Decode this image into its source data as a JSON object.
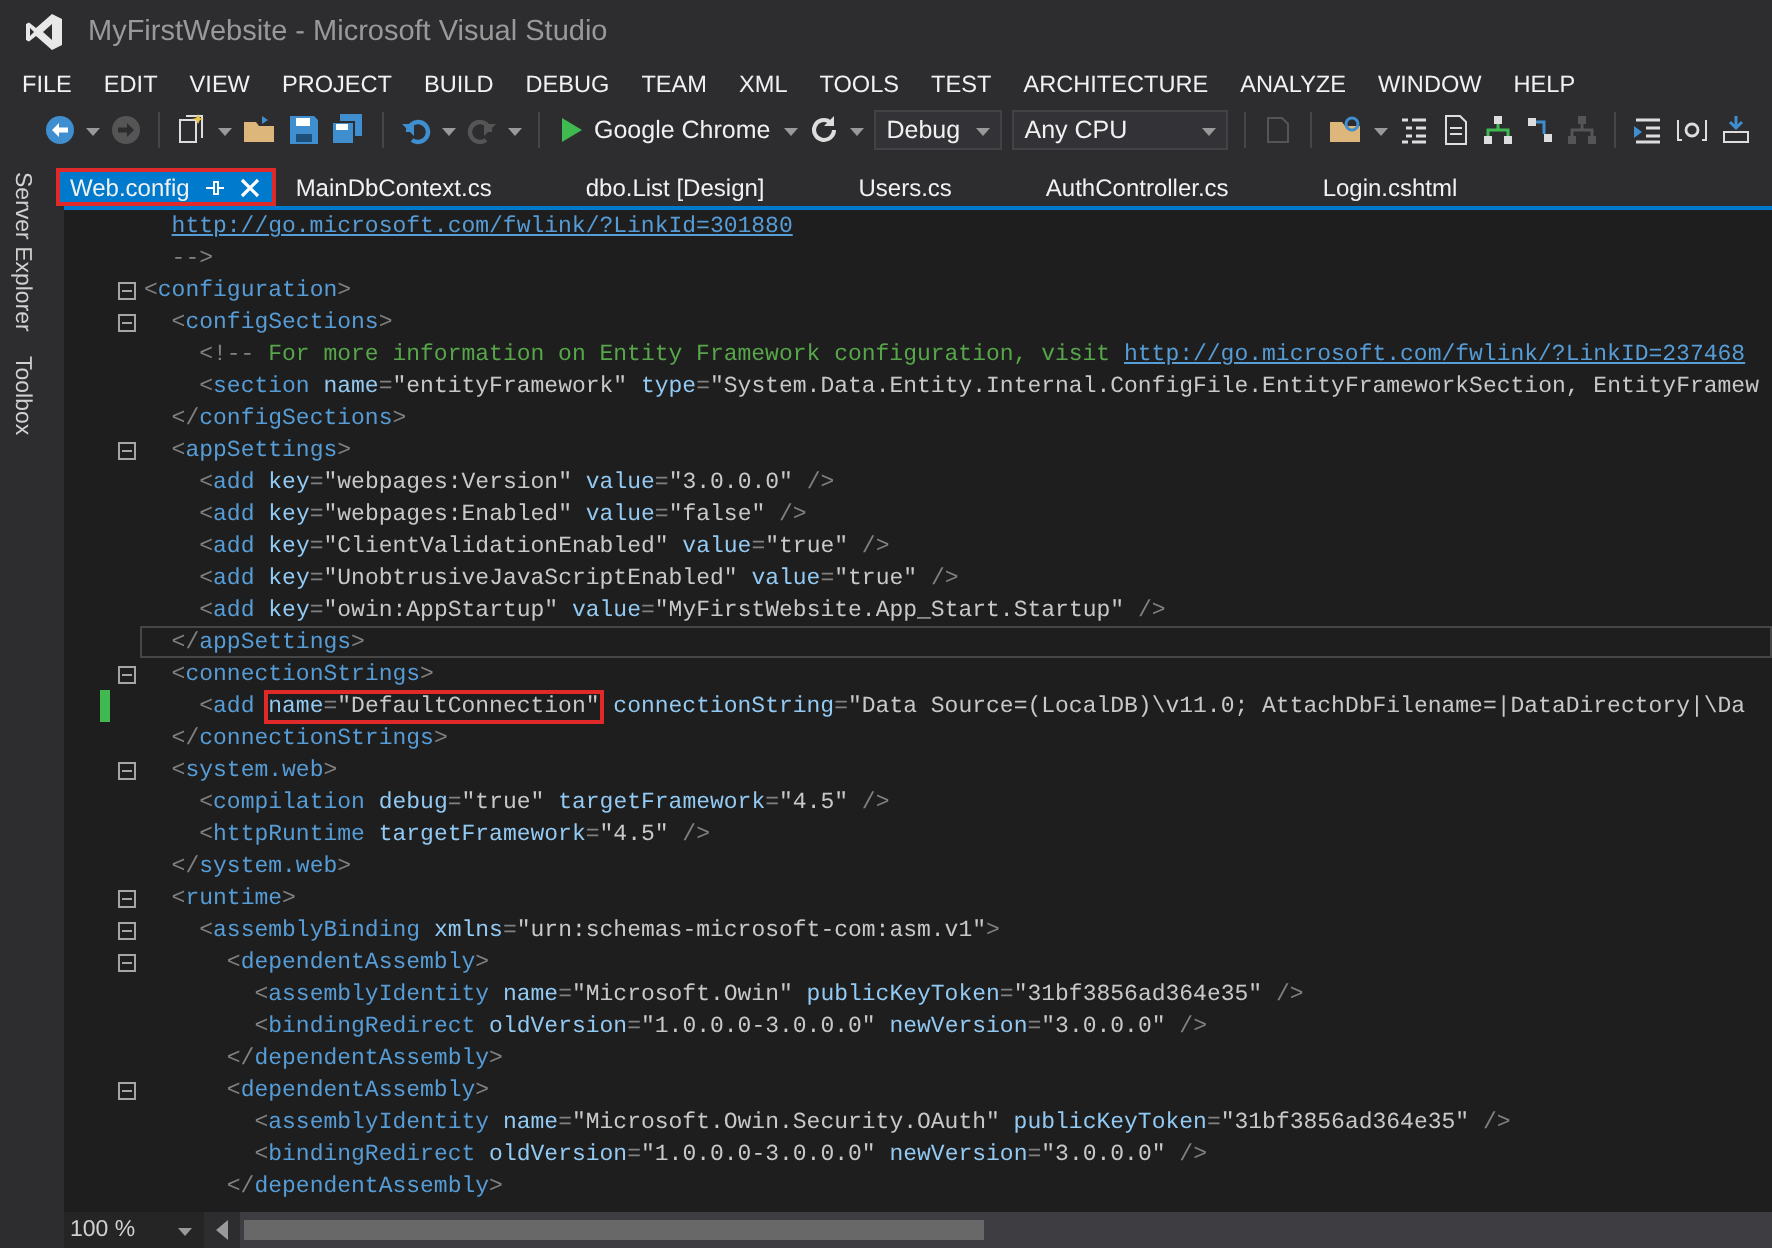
{
  "window": {
    "title": "MyFirstWebsite - Microsoft Visual Studio"
  },
  "menu": [
    "FILE",
    "EDIT",
    "VIEW",
    "PROJECT",
    "BUILD",
    "DEBUG",
    "TEAM",
    "XML",
    "TOOLS",
    "TEST",
    "ARCHITECTURE",
    "ANALYZE",
    "WINDOW",
    "HELP"
  ],
  "toolbar": {
    "run_target": "Google Chrome",
    "configuration": "Debug",
    "platform": "Any CPU"
  },
  "side_tabs": [
    "Server Explorer",
    "Toolbox"
  ],
  "tabs": [
    {
      "label": "Web.config",
      "selected": true,
      "highlighted": true
    },
    {
      "label": "MainDbContext.cs",
      "selected": false,
      "highlighted": false
    },
    {
      "label": "dbo.List [Design]",
      "selected": false,
      "highlighted": false
    },
    {
      "label": "Users.cs",
      "selected": false,
      "highlighted": false
    },
    {
      "label": "AuthController.cs",
      "selected": false,
      "highlighted": false
    },
    {
      "label": "Login.cshtml",
      "selected": false,
      "highlighted": false
    }
  ],
  "editor": {
    "lines": [
      {
        "kind": "continuation",
        "fold": false,
        "changed": false,
        "current": false,
        "tokens": [
          {
            "kind": "link",
            "text": "http://go.microsoft.com/fwlink/?LinkId=301880"
          }
        ]
      },
      {
        "kind": "markup",
        "fold": false,
        "changed": false,
        "current": false,
        "tokens": [
          {
            "kind": "punct",
            "text": "  -->"
          }
        ]
      },
      {
        "kind": "markup",
        "fold": true,
        "changed": false,
        "current": false,
        "tokens": [
          {
            "kind": "punct",
            "text": "<"
          },
          {
            "kind": "tag",
            "text": "configuration"
          },
          {
            "kind": "punct",
            "text": ">"
          }
        ]
      },
      {
        "kind": "markup",
        "fold": true,
        "changed": false,
        "current": false,
        "tokens": [
          {
            "kind": "punct",
            "text": "  <"
          },
          {
            "kind": "tag",
            "text": "configSections"
          },
          {
            "kind": "punct",
            "text": ">"
          }
        ]
      },
      {
        "kind": "markup",
        "fold": false,
        "changed": false,
        "current": false,
        "tokens": [
          {
            "kind": "punct",
            "text": "    <!--"
          },
          {
            "kind": "comment",
            "text": " For more information on Entity Framework configuration, visit "
          },
          {
            "kind": "link",
            "text": "http://go.microsoft.com/fwlink/?LinkID=237468"
          }
        ]
      },
      {
        "kind": "markup",
        "fold": false,
        "changed": false,
        "current": false,
        "tokens": [
          {
            "kind": "punct",
            "text": "    <"
          },
          {
            "kind": "tag",
            "text": "section"
          },
          {
            "kind": "attr",
            "text": " name"
          },
          {
            "kind": "punct",
            "text": "="
          },
          {
            "kind": "value",
            "text": "\"entityFramework\""
          },
          {
            "kind": "attr",
            "text": " type"
          },
          {
            "kind": "punct",
            "text": "="
          },
          {
            "kind": "value",
            "text": "\"System.Data.Entity.Internal.ConfigFile.EntityFrameworkSection, EntityFramew"
          }
        ]
      },
      {
        "kind": "markup",
        "fold": false,
        "changed": false,
        "current": false,
        "tokens": [
          {
            "kind": "punct",
            "text": "  </"
          },
          {
            "kind": "tag",
            "text": "configSections"
          },
          {
            "kind": "punct",
            "text": ">"
          }
        ]
      },
      {
        "kind": "markup",
        "fold": true,
        "changed": false,
        "current": false,
        "tokens": [
          {
            "kind": "punct",
            "text": "  <"
          },
          {
            "kind": "tag",
            "text": "appSettings"
          },
          {
            "kind": "punct",
            "text": ">"
          }
        ]
      },
      {
        "kind": "markup",
        "fold": false,
        "changed": false,
        "current": false,
        "tokens": [
          {
            "kind": "punct",
            "text": "    <"
          },
          {
            "kind": "tag",
            "text": "add"
          },
          {
            "kind": "attr",
            "text": " key"
          },
          {
            "kind": "punct",
            "text": "="
          },
          {
            "kind": "value",
            "text": "\"webpages:Version\""
          },
          {
            "kind": "attr",
            "text": " value"
          },
          {
            "kind": "punct",
            "text": "="
          },
          {
            "kind": "value",
            "text": "\"3.0.0.0\""
          },
          {
            "kind": "punct",
            "text": " />"
          }
        ]
      },
      {
        "kind": "markup",
        "fold": false,
        "changed": false,
        "current": false,
        "tokens": [
          {
            "kind": "punct",
            "text": "    <"
          },
          {
            "kind": "tag",
            "text": "add"
          },
          {
            "kind": "attr",
            "text": " key"
          },
          {
            "kind": "punct",
            "text": "="
          },
          {
            "kind": "value",
            "text": "\"webpages:Enabled\""
          },
          {
            "kind": "attr",
            "text": " value"
          },
          {
            "kind": "punct",
            "text": "="
          },
          {
            "kind": "value",
            "text": "\"false\""
          },
          {
            "kind": "punct",
            "text": " />"
          }
        ]
      },
      {
        "kind": "markup",
        "fold": false,
        "changed": false,
        "current": false,
        "tokens": [
          {
            "kind": "punct",
            "text": "    <"
          },
          {
            "kind": "tag",
            "text": "add"
          },
          {
            "kind": "attr",
            "text": " key"
          },
          {
            "kind": "punct",
            "text": "="
          },
          {
            "kind": "value",
            "text": "\"ClientValidationEnabled\""
          },
          {
            "kind": "attr",
            "text": " value"
          },
          {
            "kind": "punct",
            "text": "="
          },
          {
            "kind": "value",
            "text": "\"true\""
          },
          {
            "kind": "punct",
            "text": " />"
          }
        ]
      },
      {
        "kind": "markup",
        "fold": false,
        "changed": false,
        "current": false,
        "tokens": [
          {
            "kind": "punct",
            "text": "    <"
          },
          {
            "kind": "tag",
            "text": "add"
          },
          {
            "kind": "attr",
            "text": " key"
          },
          {
            "kind": "punct",
            "text": "="
          },
          {
            "kind": "value",
            "text": "\"UnobtrusiveJavaScriptEnabled\""
          },
          {
            "kind": "attr",
            "text": " value"
          },
          {
            "kind": "punct",
            "text": "="
          },
          {
            "kind": "value",
            "text": "\"true\""
          },
          {
            "kind": "punct",
            "text": " />"
          }
        ]
      },
      {
        "kind": "markup",
        "fold": false,
        "changed": false,
        "current": false,
        "tokens": [
          {
            "kind": "punct",
            "text": "    <"
          },
          {
            "kind": "tag",
            "text": "add"
          },
          {
            "kind": "attr",
            "text": " key"
          },
          {
            "kind": "punct",
            "text": "="
          },
          {
            "kind": "value",
            "text": "\"owin:AppStartup\""
          },
          {
            "kind": "attr",
            "text": " value"
          },
          {
            "kind": "punct",
            "text": "="
          },
          {
            "kind": "value",
            "text": "\"MyFirstWebsite.App_Start.Startup\""
          },
          {
            "kind": "punct",
            "text": " />"
          }
        ]
      },
      {
        "kind": "markup",
        "fold": false,
        "changed": false,
        "current": true,
        "tokens": [
          {
            "kind": "punct",
            "text": "  </"
          },
          {
            "kind": "tag",
            "text": "appSettings"
          },
          {
            "kind": "punct",
            "text": ">"
          }
        ]
      },
      {
        "kind": "markup",
        "fold": true,
        "changed": false,
        "current": false,
        "tokens": [
          {
            "kind": "punct",
            "text": "  <"
          },
          {
            "kind": "tag",
            "text": "connectionStrings"
          },
          {
            "kind": "punct",
            "text": ">"
          }
        ]
      },
      {
        "kind": "markup",
        "fold": false,
        "changed": true,
        "current": false,
        "tokens": [
          {
            "kind": "punct",
            "text": "    <"
          },
          {
            "kind": "tag",
            "text": "add "
          },
          {
            "kind": "marked",
            "tokens": [
              {
                "kind": "attr",
                "text": "name"
              },
              {
                "kind": "punct",
                "text": "="
              },
              {
                "kind": "value",
                "text": "\"DefaultConnection\""
              }
            ]
          },
          {
            "kind": "attr",
            "text": " connectionString"
          },
          {
            "kind": "punct",
            "text": "="
          },
          {
            "kind": "value",
            "text": "\"Data Source=(LocalDB)\\v11.0; AttachDbFilename=|DataDirectory|\\Da"
          }
        ]
      },
      {
        "kind": "markup",
        "fold": false,
        "changed": false,
        "current": false,
        "tokens": [
          {
            "kind": "punct",
            "text": "  </"
          },
          {
            "kind": "tag",
            "text": "connectionStrings"
          },
          {
            "kind": "punct",
            "text": ">"
          }
        ]
      },
      {
        "kind": "markup",
        "fold": true,
        "changed": false,
        "current": false,
        "tokens": [
          {
            "kind": "punct",
            "text": "  <"
          },
          {
            "kind": "tag",
            "text": "system.web"
          },
          {
            "kind": "punct",
            "text": ">"
          }
        ]
      },
      {
        "kind": "markup",
        "fold": false,
        "changed": false,
        "current": false,
        "tokens": [
          {
            "kind": "punct",
            "text": "    <"
          },
          {
            "kind": "tag",
            "text": "compilation"
          },
          {
            "kind": "attr",
            "text": " debug"
          },
          {
            "kind": "punct",
            "text": "="
          },
          {
            "kind": "value",
            "text": "\"true\""
          },
          {
            "kind": "attr",
            "text": " targetFramework"
          },
          {
            "kind": "punct",
            "text": "="
          },
          {
            "kind": "value",
            "text": "\"4.5\""
          },
          {
            "kind": "punct",
            "text": " />"
          }
        ]
      },
      {
        "kind": "markup",
        "fold": false,
        "changed": false,
        "current": false,
        "tokens": [
          {
            "kind": "punct",
            "text": "    <"
          },
          {
            "kind": "tag",
            "text": "httpRuntime"
          },
          {
            "kind": "attr",
            "text": " targetFramework"
          },
          {
            "kind": "punct",
            "text": "="
          },
          {
            "kind": "value",
            "text": "\"4.5\""
          },
          {
            "kind": "punct",
            "text": " />"
          }
        ]
      },
      {
        "kind": "markup",
        "fold": false,
        "changed": false,
        "current": false,
        "tokens": [
          {
            "kind": "punct",
            "text": "  </"
          },
          {
            "kind": "tag",
            "text": "system.web"
          },
          {
            "kind": "punct",
            "text": ">"
          }
        ]
      },
      {
        "kind": "markup",
        "fold": true,
        "changed": false,
        "current": false,
        "tokens": [
          {
            "kind": "punct",
            "text": "  <"
          },
          {
            "kind": "tag",
            "text": "runtime"
          },
          {
            "kind": "punct",
            "text": ">"
          }
        ]
      },
      {
        "kind": "markup",
        "fold": true,
        "changed": false,
        "current": false,
        "tokens": [
          {
            "kind": "punct",
            "text": "    <"
          },
          {
            "kind": "tag",
            "text": "assemblyBinding"
          },
          {
            "kind": "attr",
            "text": " xmlns"
          },
          {
            "kind": "punct",
            "text": "="
          },
          {
            "kind": "value",
            "text": "\"urn:schemas-microsoft-com:asm.v1\""
          },
          {
            "kind": "punct",
            "text": ">"
          }
        ]
      },
      {
        "kind": "markup",
        "fold": true,
        "changed": false,
        "current": false,
        "tokens": [
          {
            "kind": "punct",
            "text": "      <"
          },
          {
            "kind": "tag",
            "text": "dependentAssembly"
          },
          {
            "kind": "punct",
            "text": ">"
          }
        ]
      },
      {
        "kind": "markup",
        "fold": false,
        "changed": false,
        "current": false,
        "tokens": [
          {
            "kind": "punct",
            "text": "        <"
          },
          {
            "kind": "tag",
            "text": "assemblyIdentity"
          },
          {
            "kind": "attr",
            "text": " name"
          },
          {
            "kind": "punct",
            "text": "="
          },
          {
            "kind": "value",
            "text": "\"Microsoft.Owin\""
          },
          {
            "kind": "attr",
            "text": " publicKeyToken"
          },
          {
            "kind": "punct",
            "text": "="
          },
          {
            "kind": "value",
            "text": "\"31bf3856ad364e35\""
          },
          {
            "kind": "punct",
            "text": " />"
          }
        ]
      },
      {
        "kind": "markup",
        "fold": false,
        "changed": false,
        "current": false,
        "tokens": [
          {
            "kind": "punct",
            "text": "        <"
          },
          {
            "kind": "tag",
            "text": "bindingRedirect"
          },
          {
            "kind": "attr",
            "text": " oldVersion"
          },
          {
            "kind": "punct",
            "text": "="
          },
          {
            "kind": "value",
            "text": "\"1.0.0.0-3.0.0.0\""
          },
          {
            "kind": "attr",
            "text": " newVersion"
          },
          {
            "kind": "punct",
            "text": "="
          },
          {
            "kind": "value",
            "text": "\"3.0.0.0\""
          },
          {
            "kind": "punct",
            "text": " />"
          }
        ]
      },
      {
        "kind": "markup",
        "fold": false,
        "changed": false,
        "current": false,
        "tokens": [
          {
            "kind": "punct",
            "text": "      </"
          },
          {
            "kind": "tag",
            "text": "dependentAssembly"
          },
          {
            "kind": "punct",
            "text": ">"
          }
        ]
      },
      {
        "kind": "markup",
        "fold": true,
        "changed": false,
        "current": false,
        "tokens": [
          {
            "kind": "punct",
            "text": "      <"
          },
          {
            "kind": "tag",
            "text": "dependentAssembly"
          },
          {
            "kind": "punct",
            "text": ">"
          }
        ]
      },
      {
        "kind": "markup",
        "fold": false,
        "changed": false,
        "current": false,
        "tokens": [
          {
            "kind": "punct",
            "text": "        <"
          },
          {
            "kind": "tag",
            "text": "assemblyIdentity"
          },
          {
            "kind": "attr",
            "text": " name"
          },
          {
            "kind": "punct",
            "text": "="
          },
          {
            "kind": "value",
            "text": "\"Microsoft.Owin.Security.OAuth\""
          },
          {
            "kind": "attr",
            "text": " publicKeyToken"
          },
          {
            "kind": "punct",
            "text": "="
          },
          {
            "kind": "value",
            "text": "\"31bf3856ad364e35\""
          },
          {
            "kind": "punct",
            "text": " />"
          }
        ]
      },
      {
        "kind": "markup",
        "fold": false,
        "changed": false,
        "current": false,
        "tokens": [
          {
            "kind": "punct",
            "text": "        <"
          },
          {
            "kind": "tag",
            "text": "bindingRedirect"
          },
          {
            "kind": "attr",
            "text": " oldVersion"
          },
          {
            "kind": "punct",
            "text": "="
          },
          {
            "kind": "value",
            "text": "\"1.0.0.0-3.0.0.0\""
          },
          {
            "kind": "attr",
            "text": " newVersion"
          },
          {
            "kind": "punct",
            "text": "="
          },
          {
            "kind": "value",
            "text": "\"3.0.0.0\""
          },
          {
            "kind": "punct",
            "text": " />"
          }
        ]
      },
      {
        "kind": "markup",
        "fold": false,
        "changed": false,
        "current": false,
        "tokens": [
          {
            "kind": "punct",
            "text": "      </"
          },
          {
            "kind": "tag",
            "text": "dependentAssembly"
          },
          {
            "kind": "punct",
            "text": ">"
          }
        ]
      }
    ]
  },
  "status_bar": {
    "zoom": "100 %"
  }
}
